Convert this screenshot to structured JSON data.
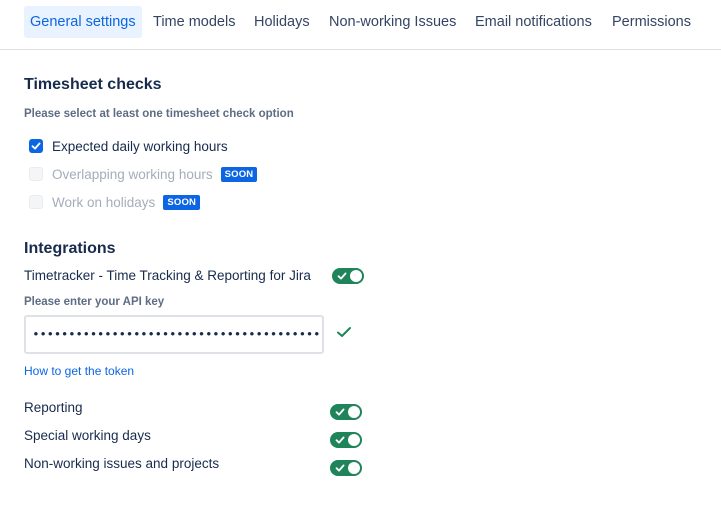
{
  "tabs": [
    {
      "label": "General settings",
      "active": true
    },
    {
      "label": "Time models"
    },
    {
      "label": "Holidays"
    },
    {
      "label": "Non-working Issues"
    },
    {
      "label": "Email notifications"
    },
    {
      "label": "Permissions"
    }
  ],
  "timesheet": {
    "title": "Timesheet checks",
    "helper": "Please select at least one timesheet check option",
    "options": [
      {
        "label": "Expected daily working hours",
        "checked": true,
        "disabled": false
      },
      {
        "label": "Overlapping working hours",
        "checked": false,
        "disabled": true,
        "badge": "SOON"
      },
      {
        "label": "Work on holidays",
        "checked": false,
        "disabled": true,
        "badge": "SOON"
      }
    ]
  },
  "integrations": {
    "title": "Integrations",
    "timetracker": {
      "label": "Timetracker - Time Tracking & Reporting for Jira",
      "enabled": true
    },
    "api_key": {
      "label": "Please enter your API key",
      "value": "••••••••••••••••••••••••••••••••••••••••••••••••",
      "valid": true
    },
    "token_link": "How to get the token",
    "features": [
      {
        "label": "Reporting",
        "enabled": true
      },
      {
        "label": "Special working days",
        "enabled": true
      },
      {
        "label": "Non-working issues and projects",
        "enabled": true
      }
    ]
  },
  "colors": {
    "accent": "#0c66e4",
    "toggle_on": "#1f845a",
    "valid": "#1f845a"
  },
  "icons": {
    "checkbox_checked": "checkmark-icon",
    "valid": "checkmark-icon"
  }
}
